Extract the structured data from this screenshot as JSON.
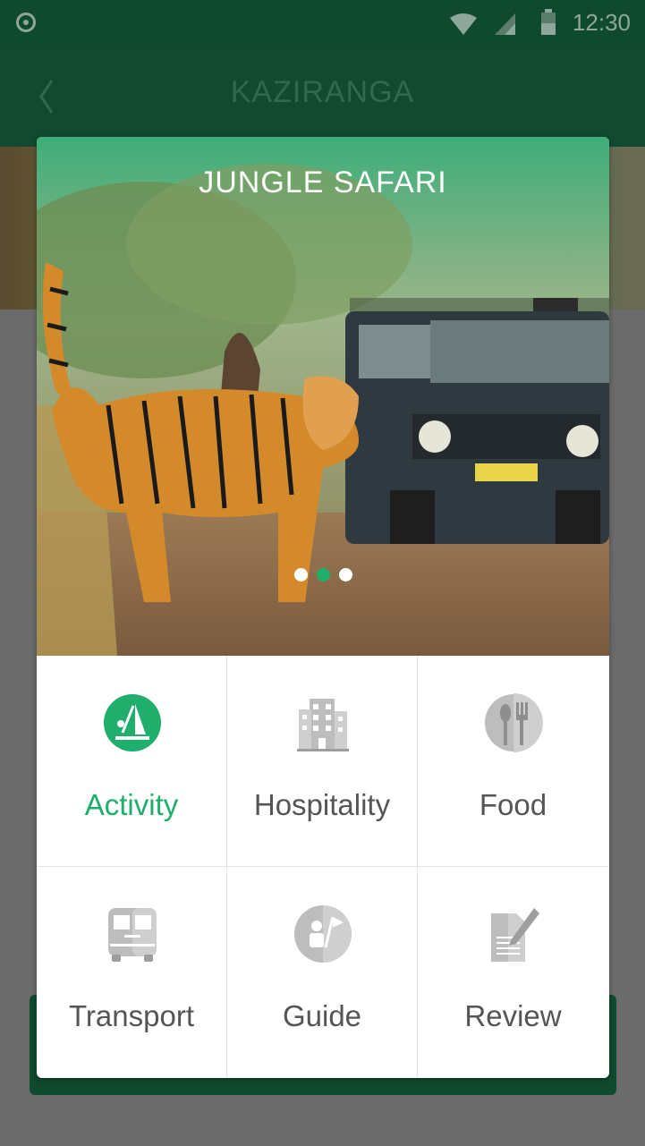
{
  "status_bar": {
    "time": "12:30"
  },
  "app_bar": {
    "title": "KAZIRANGA"
  },
  "hero": {
    "title": "JUNGLE SAFARI",
    "carousel_dots": 3,
    "active_dot": 2
  },
  "menu": [
    {
      "label": "Activity",
      "icon": "activity-icon",
      "active": true
    },
    {
      "label": "Hospitality",
      "icon": "building-icon",
      "active": false
    },
    {
      "label": "Food",
      "icon": "food-icon",
      "active": false
    },
    {
      "label": "Transport",
      "icon": "bus-icon",
      "active": false
    },
    {
      "label": "Guide",
      "icon": "guide-icon",
      "active": false
    },
    {
      "label": "Review",
      "icon": "review-icon",
      "active": false
    }
  ],
  "colors": {
    "brand_dark_green": "#0f4a2f",
    "accent_green": "#1fae6b",
    "inactive_grey": "#bdbdbd"
  }
}
